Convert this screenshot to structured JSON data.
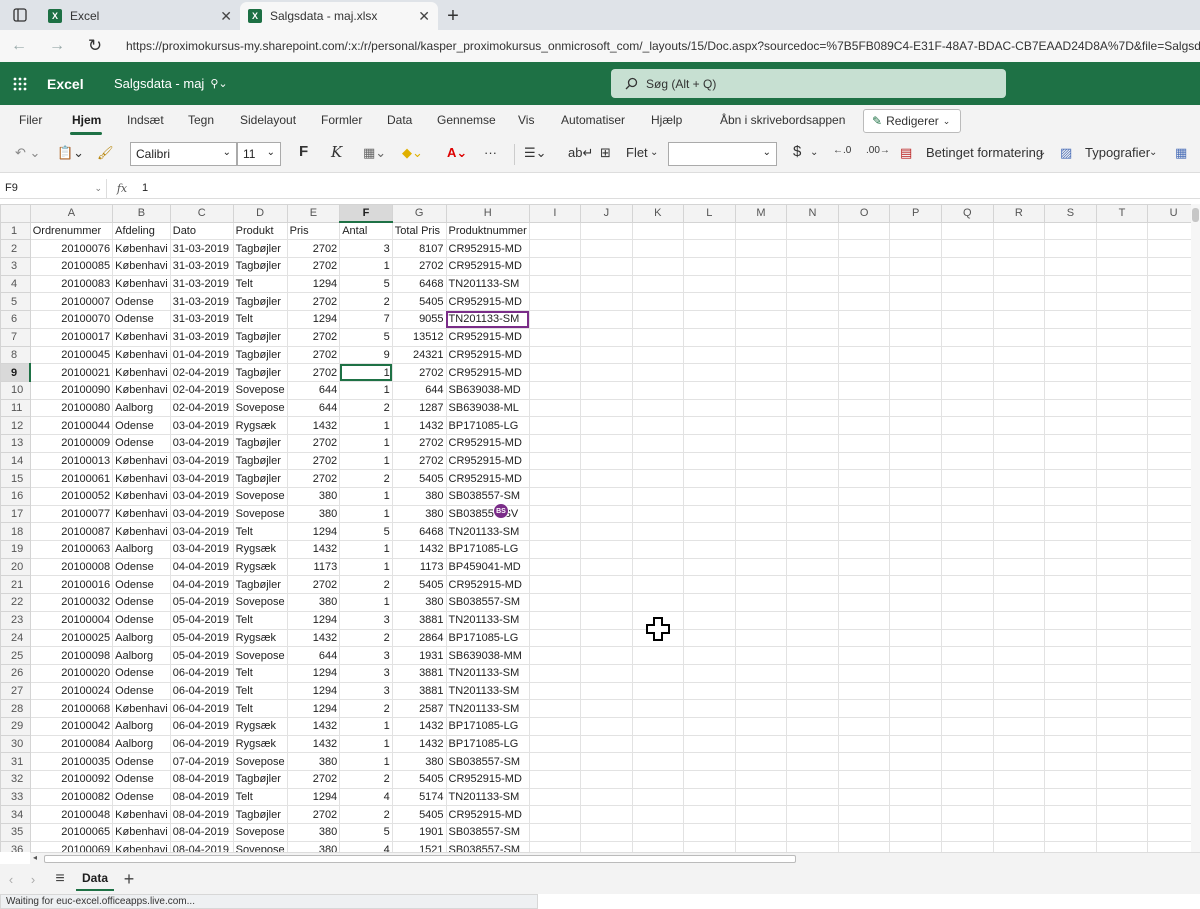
{
  "browser": {
    "tabs": [
      {
        "title": "Excel",
        "active": false
      },
      {
        "title": "Salgsdata - maj.xlsx",
        "active": true
      }
    ],
    "url": "https://proximokursus-my.sharepoint.com/:x:/r/personal/kasper_proximokursus_onmicrosoft_com/_layouts/15/Doc.aspx?sourcedoc=%7B5FB089C4-E31F-48A7-BDAC-CB7EAAD24D8A%7D&file=Salgsdata"
  },
  "app": {
    "name": "Excel",
    "doc_title": "Salgsdata - maj",
    "search_placeholder": "Søg (Alt + Q)",
    "brand_color": "#1e7145"
  },
  "ribbon": {
    "tabs": [
      "Filer",
      "Hjem",
      "Indsæt",
      "Tegn",
      "Sidelayout",
      "Formler",
      "Data",
      "Gennemse",
      "Vis",
      "Automatiser",
      "Hjælp",
      "Åbn i skrivebordsappen"
    ],
    "active_tab": "Hjem",
    "edit_mode": "Redigerer",
    "font_name": "Calibri",
    "font_size": "11",
    "bold": "F",
    "italic": "K",
    "more": "···",
    "merge_label": "Flet",
    "number_format": "",
    "currency": "$",
    "conditional_formatting": "Betinget formatering",
    "styles": "Typografier"
  },
  "formula_bar": {
    "cell_ref": "F9",
    "fx": "fx",
    "value": "1"
  },
  "sheet": {
    "columns": [
      "A",
      "B",
      "C",
      "D",
      "E",
      "F",
      "G",
      "H",
      "I",
      "J",
      "K",
      "L",
      "M",
      "N",
      "O",
      "P",
      "Q",
      "R",
      "S",
      "T",
      "U"
    ],
    "selected_column": "F",
    "selected_row": 9,
    "header": [
      "Ordrenummer",
      "Afdeling",
      "Dato",
      "Produkt",
      "Pris",
      "Antal",
      "Total Pris",
      "Produktnummer"
    ],
    "rows": [
      [
        "20100076",
        "Københavi",
        "31-03-2019",
        "Tagbøjler",
        "2702",
        "3",
        "8107",
        "CR952915-MD"
      ],
      [
        "20100085",
        "Københavi",
        "31-03-2019",
        "Tagbøjler",
        "2702",
        "1",
        "2702",
        "CR952915-MD"
      ],
      [
        "20100083",
        "Københavi",
        "31-03-2019",
        "Telt",
        "1294",
        "5",
        "6468",
        "TN201133-SM"
      ],
      [
        "20100007",
        "Odense",
        "31-03-2019",
        "Tagbøjler",
        "2702",
        "2",
        "5405",
        "CR952915-MD"
      ],
      [
        "20100070",
        "Odense",
        "31-03-2019",
        "Telt",
        "1294",
        "7",
        "9055",
        "TN201133-SM"
      ],
      [
        "20100017",
        "Københavi",
        "31-03-2019",
        "Tagbøjler",
        "2702",
        "5",
        "13512",
        "CR952915-MD"
      ],
      [
        "20100045",
        "Københavi",
        "01-04-2019",
        "Tagbøjler",
        "2702",
        "9",
        "24321",
        "CR952915-MD"
      ],
      [
        "20100021",
        "Københavi",
        "02-04-2019",
        "Tagbøjler",
        "2702",
        "1",
        "2702",
        "CR952915-MD"
      ],
      [
        "20100090",
        "Københavi",
        "02-04-2019",
        "Sovepose",
        "644",
        "1",
        "644",
        "SB639038-MD"
      ],
      [
        "20100080",
        "Aalborg",
        "02-04-2019",
        "Sovepose",
        "644",
        "2",
        "1287",
        "SB639038-ML"
      ],
      [
        "20100044",
        "Odense",
        "03-04-2019",
        "Rygsæk",
        "1432",
        "1",
        "1432",
        "BP171085-LG"
      ],
      [
        "20100009",
        "Odense",
        "03-04-2019",
        "Tagbøjler",
        "2702",
        "1",
        "2702",
        "CR952915-MD"
      ],
      [
        "20100013",
        "Københavi",
        "03-04-2019",
        "Tagbøjler",
        "2702",
        "1",
        "2702",
        "CR952915-MD"
      ],
      [
        "20100061",
        "Københavi",
        "03-04-2019",
        "Tagbøjler",
        "2702",
        "2",
        "5405",
        "CR952915-MD"
      ],
      [
        "20100052",
        "Københavi",
        "03-04-2019",
        "Sovepose",
        "380",
        "1",
        "380",
        "SB038557-SM"
      ],
      [
        "20100077",
        "Københavi",
        "03-04-2019",
        "Sovepose",
        "380",
        "1",
        "380",
        "SB038557-SV"
      ],
      [
        "20100087",
        "Københavi",
        "03-04-2019",
        "Telt",
        "1294",
        "5",
        "6468",
        "TN201133-SM"
      ],
      [
        "20100063",
        "Aalborg",
        "03-04-2019",
        "Rygsæk",
        "1432",
        "1",
        "1432",
        "BP171085-LG"
      ],
      [
        "20100008",
        "Odense",
        "04-04-2019",
        "Rygsæk",
        "1173",
        "1",
        "1173",
        "BP459041-MD"
      ],
      [
        "20100016",
        "Odense",
        "04-04-2019",
        "Tagbøjler",
        "2702",
        "2",
        "5405",
        "CR952915-MD"
      ],
      [
        "20100032",
        "Odense",
        "05-04-2019",
        "Sovepose",
        "380",
        "1",
        "380",
        "SB038557-SM"
      ],
      [
        "20100004",
        "Odense",
        "05-04-2019",
        "Telt",
        "1294",
        "3",
        "3881",
        "TN201133-SM"
      ],
      [
        "20100025",
        "Aalborg",
        "05-04-2019",
        "Rygsæk",
        "1432",
        "2",
        "2864",
        "BP171085-LG"
      ],
      [
        "20100098",
        "Aalborg",
        "05-04-2019",
        "Sovepose",
        "644",
        "3",
        "1931",
        "SB639038-MM"
      ],
      [
        "20100020",
        "Odense",
        "06-04-2019",
        "Telt",
        "1294",
        "3",
        "3881",
        "TN201133-SM"
      ],
      [
        "20100024",
        "Odense",
        "06-04-2019",
        "Telt",
        "1294",
        "3",
        "3881",
        "TN201133-SM"
      ],
      [
        "20100068",
        "Københavi",
        "06-04-2019",
        "Telt",
        "1294",
        "2",
        "2587",
        "TN201133-SM"
      ],
      [
        "20100042",
        "Aalborg",
        "06-04-2019",
        "Rygsæk",
        "1432",
        "1",
        "1432",
        "BP171085-LG"
      ],
      [
        "20100084",
        "Aalborg",
        "06-04-2019",
        "Rygsæk",
        "1432",
        "1",
        "1432",
        "BP171085-LG"
      ],
      [
        "20100035",
        "Odense",
        "07-04-2019",
        "Sovepose",
        "380",
        "1",
        "380",
        "SB038557-SM"
      ],
      [
        "20100092",
        "Odense",
        "08-04-2019",
        "Tagbøjler",
        "2702",
        "2",
        "5405",
        "CR952915-MD"
      ],
      [
        "20100082",
        "Odense",
        "08-04-2019",
        "Telt",
        "1294",
        "4",
        "5174",
        "TN201133-SM"
      ],
      [
        "20100048",
        "Københavi",
        "08-04-2019",
        "Tagbøjler",
        "2702",
        "2",
        "5405",
        "CR952915-MD"
      ],
      [
        "20100065",
        "Københavi",
        "08-04-2019",
        "Sovepose",
        "380",
        "5",
        "1901",
        "SB038557-SM"
      ],
      [
        "20100069",
        "Københavi",
        "08-04-2019",
        "Sovepose",
        "380",
        "4",
        "1521",
        "SB038557-SM"
      ]
    ],
    "coauthor_initials": "BS"
  },
  "sheet_tabs": {
    "menu": "≡",
    "active": "Data",
    "add": "+"
  },
  "status": "Waiting for euc-excel.officeapps.live.com..."
}
